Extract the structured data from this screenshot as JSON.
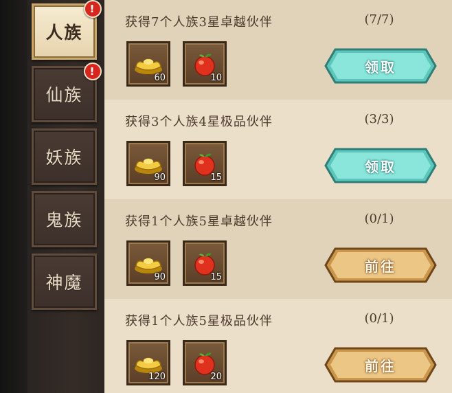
{
  "tabs": [
    {
      "label": "人族",
      "active": true,
      "badge": "!"
    },
    {
      "label": "仙族",
      "active": false,
      "badge": "!"
    },
    {
      "label": "妖族",
      "active": false,
      "badge": ""
    },
    {
      "label": "鬼族",
      "active": false,
      "badge": ""
    },
    {
      "label": "神魔",
      "active": false,
      "badge": ""
    }
  ],
  "quests": [
    {
      "title": "获得7个人族3星卓越伙伴",
      "progress": "(7/7)",
      "rewards": [
        {
          "icon": "gold-ingot-icon",
          "qty": "60"
        },
        {
          "icon": "red-fruit-icon",
          "qty": "10"
        }
      ],
      "button": "领取",
      "button_type": "claim"
    },
    {
      "title": "获得3个人族4星极品伙伴",
      "progress": "(3/3)",
      "rewards": [
        {
          "icon": "gold-ingot-icon",
          "qty": "90"
        },
        {
          "icon": "red-fruit-icon",
          "qty": "15"
        }
      ],
      "button": "领取",
      "button_type": "claim"
    },
    {
      "title": "获得1个人族5星卓越伙伴",
      "progress": "(0/1)",
      "rewards": [
        {
          "icon": "gold-ingot-icon",
          "qty": "90"
        },
        {
          "icon": "red-fruit-icon",
          "qty": "15"
        }
      ],
      "button": "前往",
      "button_type": "goto"
    },
    {
      "title": "获得1个人族5星极品伙伴",
      "progress": "(0/1)",
      "rewards": [
        {
          "icon": "gold-ingot-icon",
          "qty": "120"
        },
        {
          "icon": "red-fruit-icon",
          "qty": "20"
        }
      ],
      "button": "前往",
      "button_type": "goto"
    }
  ],
  "colors": {
    "claim_button": "#6fd8cc",
    "goto_button": "#e0b46a",
    "badge": "#d7261e",
    "active_tab": "#f2e6cc"
  }
}
